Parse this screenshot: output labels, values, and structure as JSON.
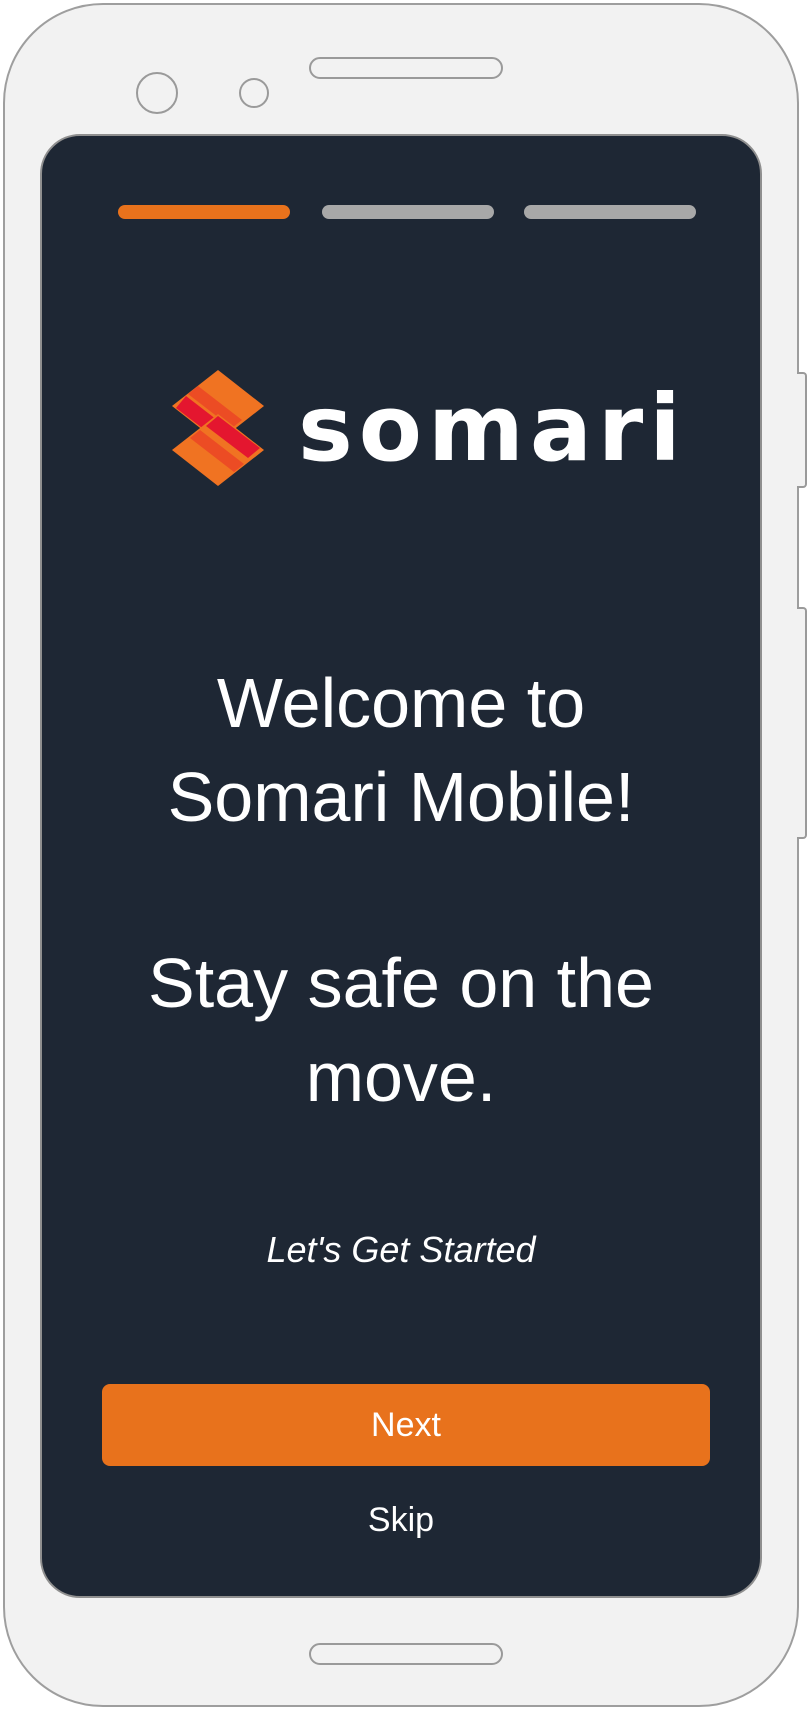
{
  "onboarding": {
    "step_count": 3,
    "current_step": 1,
    "active_color": "#e8721c",
    "inactive_color": "#a8a8a8"
  },
  "brand": {
    "name": "somari",
    "logo_icon": "somari-s-icon",
    "colors": {
      "orange": "#f07322",
      "red": "#e4162f",
      "mid": "#ec4c24"
    }
  },
  "content": {
    "welcome_line1": "Welcome to",
    "welcome_line2": "Somari Mobile!",
    "tagline_line1": "Stay safe on the",
    "tagline_line2": "move.",
    "subtitle": "Let's Get Started"
  },
  "actions": {
    "next_label": "Next",
    "skip_label": "Skip"
  },
  "theme": {
    "screen_background": "#1e2734",
    "text_color": "#ffffff",
    "button_color": "#e8721c"
  }
}
